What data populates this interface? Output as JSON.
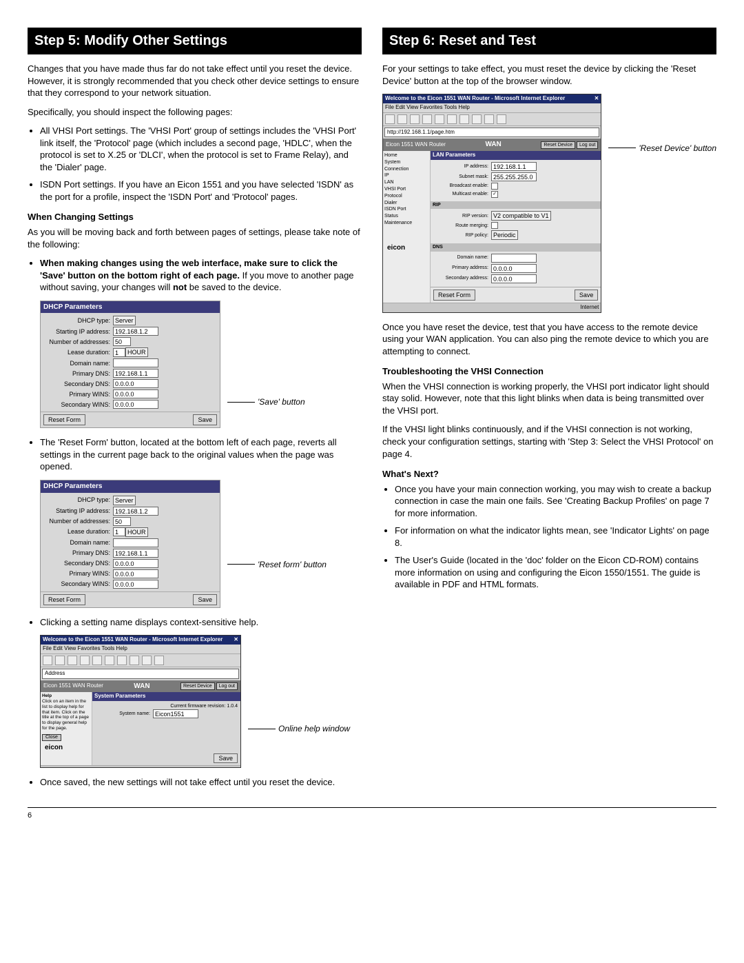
{
  "page_number": "6",
  "left": {
    "step_header": "Step 5: Modify Other Settings",
    "intro": "Changes that you have made thus far do not take effect until you reset the device. However, it is strongly recommended that you check other device settings to ensure that they correspond to your network situation.",
    "inspect_intro": "Specifically, you should inspect the following pages:",
    "bullets_a": [
      "All VHSI Port settings. The 'VHSI Port' group of settings includes the 'VHSI Port' link itself, the 'Protocol' page (which includes a second page, 'HDLC', when the protocol is set to X.25 or 'DLCI', when the protocol is set to Frame Relay), and the 'Dialer' page.",
      "ISDN Port settings. If you have an Eicon 1551 and you have selected 'ISDN' as the port for a profile, inspect the 'ISDN Port' and 'Protocol' pages."
    ],
    "subhead_change": "When Changing Settings",
    "change_intro": "As you will be moving back and forth between pages of settings, please take note of the following:",
    "save_bullet_bold": "When making changes using the web interface, make sure to click the 'Save' button on the bottom right of each page.",
    "save_bullet_rest": " If you move to another page without saving, your changes will ",
    "save_bullet_not": "not",
    "save_bullet_end": " be saved to the device.",
    "dhcp_panel": {
      "title": "DHCP Parameters",
      "rows": {
        "dhcp_type_label": "DHCP type:",
        "dhcp_type_value": "Server",
        "starting_ip_label": "Starting IP address:",
        "starting_ip_value": "192.168.1.2",
        "num_addr_label": "Number of addresses:",
        "num_addr_value": "50",
        "lease_label": "Lease duration:",
        "lease_value": "1",
        "lease_unit": "HOUR",
        "domain_label": "Domain name:",
        "domain_value": "",
        "pdns_label": "Primary DNS:",
        "pdns_value": "192.168.1.1",
        "sdns_label": "Secondary DNS:",
        "sdns_value": "0.0.0.0",
        "pwins_label": "Primary WINS:",
        "pwins_value": "0.0.0.0",
        "swins_label": "Secondary WINS:",
        "swins_value": "0.0.0.0"
      },
      "reset_form": "Reset Form",
      "save": "Save"
    },
    "callout_save": "'Save' button",
    "bullet_reset_form": "The 'Reset Form' button, located at the bottom left of each page, reverts all settings in the current page back to the original values when the page was opened.",
    "callout_reset_form": "'Reset form' button",
    "bullet_help": "Clicking a setting name displays context-sensitive help.",
    "callout_help": "Online help window",
    "bullet_saved": "Once saved, the new settings will not take effect until you reset the device.",
    "ie_help": {
      "titlebar": "Welcome to the Eicon 1551 WAN Router - Microsoft Internet Explorer",
      "menu": "File  Edit  View  Favorites  Tools  Help",
      "router_name": "Eicon 1551 WAN Router",
      "wan_label": "WAN",
      "reset_device": "Reset Device",
      "logout": "Log out",
      "section_title": "System Parameters",
      "sys_name_label": "System name:",
      "sys_name_value": "Eicon1551",
      "help_title": "Help",
      "help_body": "Click on an item in the list to display help for that item. Click on the title at the top of a page to display general help for the page.",
      "close": "Close",
      "logo": "eicon",
      "save": "Save",
      "firmware": "Current firmware revision: 1.0.4"
    }
  },
  "right": {
    "step_header": "Step 6: Reset and Test",
    "intro": "For your settings to take effect, you must reset the device by clicking the 'Reset Device' button at the top of the browser window.",
    "callout_reset_device": "'Reset Device' button",
    "ie_lan": {
      "titlebar": "Welcome to the Eicon 1551 WAN Router - Microsoft Internet Explorer",
      "menu": "File  Edit  View  Favorites  Tools  Help",
      "addr": "http://192.168.1.1/page.htm",
      "router_name": "Eicon 1551 WAN Router",
      "wan_label": "WAN",
      "reset_device": "Reset Device",
      "logout": "Log out",
      "section_title": "LAN Parameters",
      "side_items": [
        "Home",
        "System",
        "Connection",
        "IP",
        "LAN",
        "VHSI Port",
        "Protocol",
        "Dialer",
        "ISDN Port",
        "Status",
        "Maintenance"
      ],
      "ip_addr_label": "IP address:",
      "ip_addr_value": "192.168.1.1",
      "subnet_label": "Subnet mask:",
      "subnet_value": "255.255.255.0",
      "bcast_label": "Broadcast enable:",
      "mcast_label": "Multicast enable:",
      "rip_title": "RIP",
      "rip_version_label": "RIP version:",
      "rip_version_value": "V2 compatible to V1",
      "route_merge_label": "Route merging:",
      "rip_policy_label": "RIP policy:",
      "rip_policy_value": "Periodic",
      "dns_title": "DNS",
      "domain_label": "Domain name:",
      "primary_label": "Primary address:",
      "primary_value": "0.0.0.0",
      "secondary_label": "Secondary address:",
      "secondary_value": "0.0.0.0",
      "reset_form": "Reset Form",
      "save": "Save",
      "logo": "eicon",
      "internet": "Internet"
    },
    "after_reset": "Once you have reset the device, test that you have access to the remote device using your WAN application. You can also ping the remote device to which you are attempting to connect.",
    "subhead_trouble": "Troubleshooting the VHSI Connection",
    "trouble_p1": "When the VHSI connection is working properly, the VHSI port indicator light should stay solid. However, note that this light blinks when data is being transmitted over the VHSI port.",
    "trouble_p2": "If the VHSI light blinks continuously, and if the VHSI connection is not working, check your configuration settings, starting with 'Step 3: Select the VHSI Protocol' on page 4.",
    "subhead_next": "What's Next?",
    "next_bullets": [
      "Once you have your main connection working, you may wish to create a backup connection in case the main one fails. See 'Creating Backup Profiles' on page 7 for more information.",
      "For information on what the indicator lights mean, see 'Indicator Lights' on page 8.",
      "The User's Guide (located in the 'doc' folder on the Eicon CD-ROM) contains more information on using and configuring the Eicon 1550/1551. The guide is available in PDF and HTML formats."
    ]
  }
}
